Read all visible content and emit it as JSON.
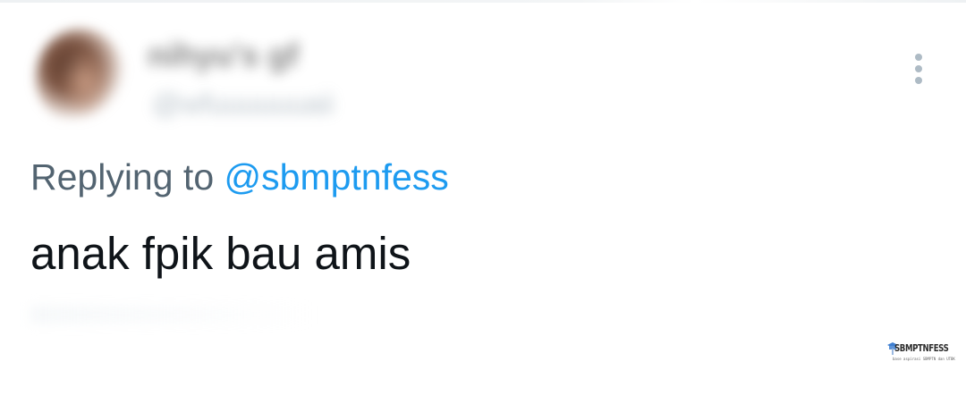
{
  "tweet": {
    "author_name": "nihyu's gf",
    "author_handle": "@wfuuuuuuaii",
    "reply_prefix": "Replying to",
    "reply_handle": "@sbmptnfess",
    "text": "anak fpik bau amis"
  },
  "icons": {
    "more": "more-vertical-icon",
    "avatar": "avatar-image"
  },
  "watermark": {
    "title": "SBMPTNFESS",
    "tagline": "base aspirasi SBMPTN dan UTBK"
  },
  "colors": {
    "text_primary": "#0f1419",
    "text_secondary": "#536471",
    "accent": "#1d9bf0",
    "icon_muted": "#aebbc5"
  }
}
